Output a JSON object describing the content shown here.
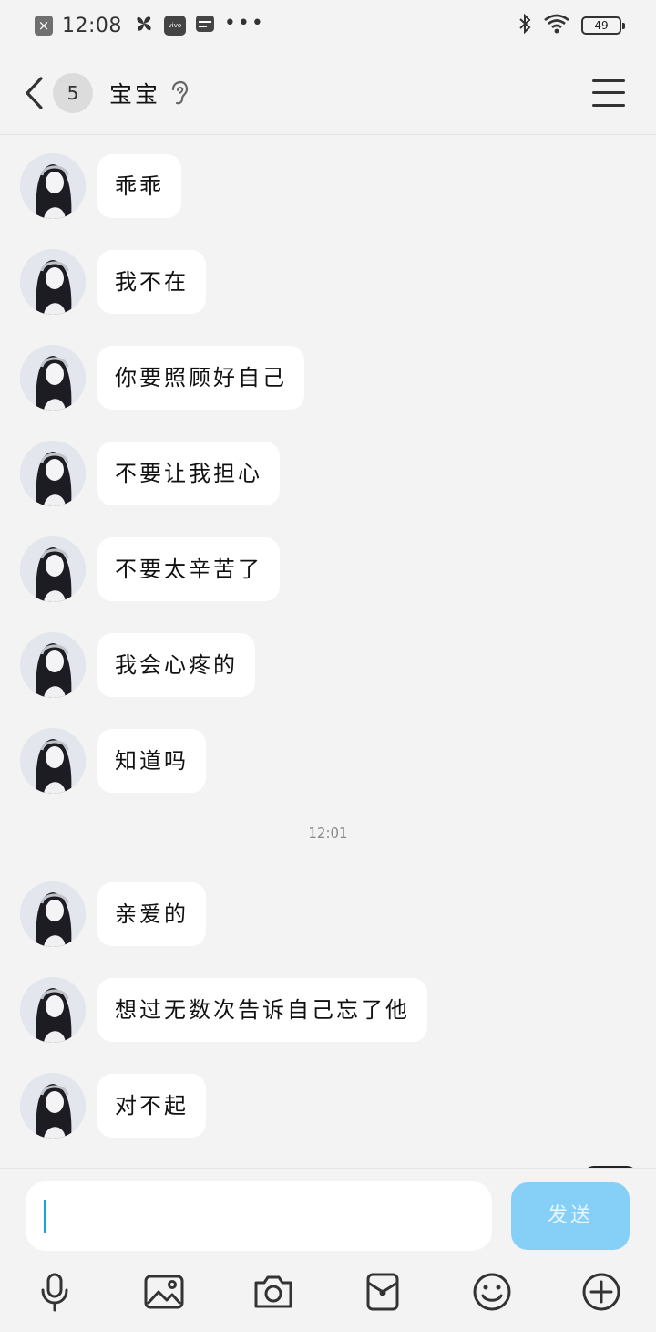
{
  "status_bar": {
    "time": "12:08",
    "badge": "vivo",
    "dots": "•••",
    "battery": "49"
  },
  "header": {
    "unread_count": "5",
    "contact_name": "宝宝"
  },
  "messages": [
    {
      "text": "乖乖"
    },
    {
      "text": "我不在"
    },
    {
      "text": "你要照顾好自己"
    },
    {
      "text": "不要让我担心"
    },
    {
      "text": "不要太辛苦了"
    },
    {
      "text": "我会心疼的"
    },
    {
      "text": "知道吗"
    },
    {
      "text": "亲爱的"
    },
    {
      "text": "想过无数次告诉自己忘了他"
    },
    {
      "text": "对不起"
    }
  ],
  "time_separator": "12:01",
  "input": {
    "value": "",
    "send_label": "发送"
  }
}
